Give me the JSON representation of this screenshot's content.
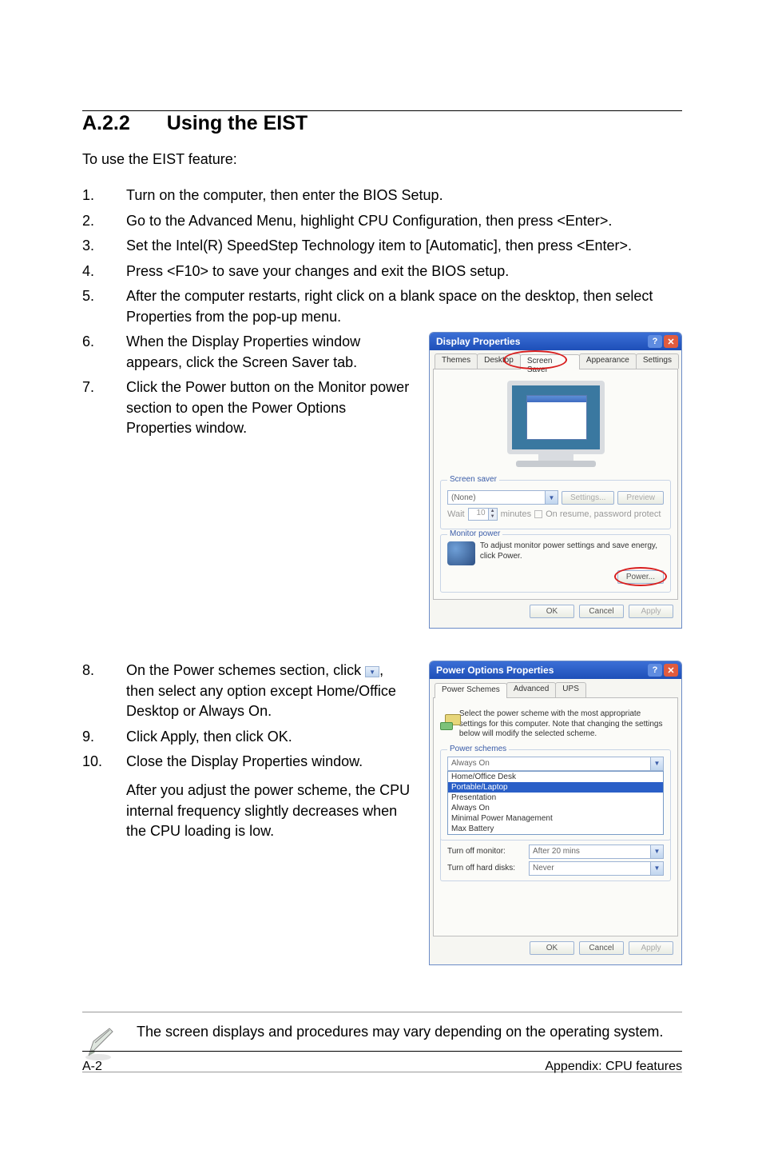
{
  "heading": {
    "number": "A.2.2",
    "title": "Using the EIST"
  },
  "intro": "To use the EIST feature:",
  "steps": [
    {
      "n": "1.",
      "text": "Turn on the computer, then enter the BIOS Setup."
    },
    {
      "n": "2.",
      "text": "Go to the Advanced Menu, highlight CPU Configuration, then press <Enter>."
    },
    {
      "n": "3.",
      "text": "Set the Intel(R) SpeedStep Technology item to [Automatic], then press <Enter>."
    },
    {
      "n": "4.",
      "text": "Press <F10> to save your changes and exit the BIOS setup."
    },
    {
      "n": "5.",
      "text": "After the computer restarts, right click on a blank space on the desktop, then select Properties from the pop-up menu."
    },
    {
      "n": "6.",
      "text": "When the Display Properties window appears, click the Screen Saver tab."
    },
    {
      "n": "7.",
      "text": "Click the Power button on the Monitor power section to open the Power Options Properties window."
    },
    {
      "n": "8.",
      "pre": "On the Power schemes section, click ",
      "post": ", then select any option except Home/Office Desktop or Always On."
    },
    {
      "n": "9.",
      "text": "Click Apply, then click OK."
    },
    {
      "n": "10.",
      "text": "Close the Display Properties window.",
      "after": "After you adjust the power scheme, the CPU internal frequency slightly decreases when the CPU loading is low."
    }
  ],
  "note": "The screen displays and procedures may vary depending on the operating system.",
  "footer": {
    "page": "A-2",
    "label": "Appendix: CPU features"
  },
  "dlgDisplay": {
    "title": "Display Properties",
    "tabs": [
      "Themes",
      "Desktop",
      "Screen Saver",
      "Appearance",
      "Settings"
    ],
    "groupSaver": {
      "legend": "Screen saver",
      "selected": "(None)",
      "settingsBtn": "Settings...",
      "previewBtn": "Preview",
      "waitLabel": "Wait",
      "waitValue": "10",
      "waitUnit": "minutes",
      "checkbox": "On resume, password protect"
    },
    "groupMonitor": {
      "legend": "Monitor power",
      "text": "To adjust monitor power settings and save energy, click Power.",
      "powerBtn": "Power..."
    },
    "buttons": {
      "ok": "OK",
      "cancel": "Cancel",
      "apply": "Apply"
    }
  },
  "dlgPower": {
    "title": "Power Options Properties",
    "tabs": [
      "Power Schemes",
      "Advanced",
      "UPS"
    ],
    "desc": "Select the power scheme with the most appropriate settings for this computer. Note that changing the settings below will modify the selected scheme.",
    "groupSchemes": {
      "legend": "Power schemes",
      "selected": "Always On",
      "options": [
        "Home/Office Desk",
        "Portable/Laptop",
        "Presentation",
        "Always On",
        "Minimal Power Management",
        "Max Battery"
      ],
      "selectedOption": "Portable/Laptop"
    },
    "groupSettings": {
      "monitorLabel": "Turn off monitor:",
      "monitorVal": "After 20 mins",
      "disksLabel": "Turn off hard disks:",
      "disksVal": "Never"
    },
    "buttons": {
      "ok": "OK",
      "cancel": "Cancel",
      "apply": "Apply"
    }
  }
}
